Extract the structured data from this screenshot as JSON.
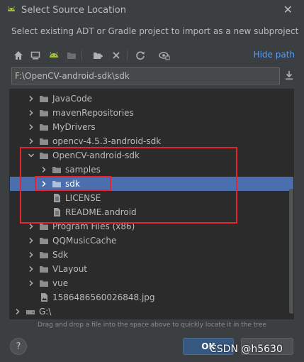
{
  "window": {
    "title": "Select Source Location",
    "subtitle": "Select existing ADT or Gradle project to import as a new subproject"
  },
  "toolbar": {
    "buttons": [
      "home-icon",
      "desktop-icon",
      "android-icon",
      "folder-icon",
      "new-folder-icon",
      "delete-icon",
      "refresh-icon",
      "show-hidden-icon"
    ],
    "hide_path_label": "Hide path"
  },
  "path": {
    "value": "F:\\OpenCV-android-sdk\\sdk"
  },
  "tree": {
    "rows": [
      {
        "label": "JavaCode",
        "type": "folder",
        "expanded": false
      },
      {
        "label": "mavenRepositories",
        "type": "folder",
        "expanded": false
      },
      {
        "label": "MyDrivers",
        "type": "folder",
        "expanded": false
      },
      {
        "label": "opencv-4.5.3-android-sdk",
        "type": "folder",
        "expanded": false
      },
      {
        "label": "OpenCV-android-sdk",
        "type": "folder",
        "expanded": true
      },
      {
        "label": "samples",
        "type": "folder",
        "expanded": false
      },
      {
        "label": "sdk",
        "type": "folder",
        "expanded": false,
        "selected": true
      },
      {
        "label": "LICENSE",
        "type": "file"
      },
      {
        "label": "README.android",
        "type": "file"
      },
      {
        "label": "Program Files (x86)",
        "type": "folder",
        "expanded": false
      },
      {
        "label": "QQMusicCache",
        "type": "folder",
        "expanded": false
      },
      {
        "label": "Sdk",
        "type": "folder",
        "expanded": false
      },
      {
        "label": "VLayout",
        "type": "folder",
        "expanded": false
      },
      {
        "label": "vue",
        "type": "folder",
        "expanded": false
      },
      {
        "label": "1586486560026848.jpg",
        "type": "image"
      },
      {
        "label": "G:\\",
        "type": "drive",
        "expanded": false
      }
    ]
  },
  "hint": "Drag and drop a file into the space above to quickly locate it in the tree",
  "buttons": {
    "help": "?",
    "ok": "OK"
  },
  "watermark": "CSDN @h5630",
  "colors": {
    "background": "#3c3f41",
    "tree_background": "#2b2b2b",
    "selection": "#4b6eaf",
    "link": "#589df6",
    "annotation": "#e8232b"
  }
}
